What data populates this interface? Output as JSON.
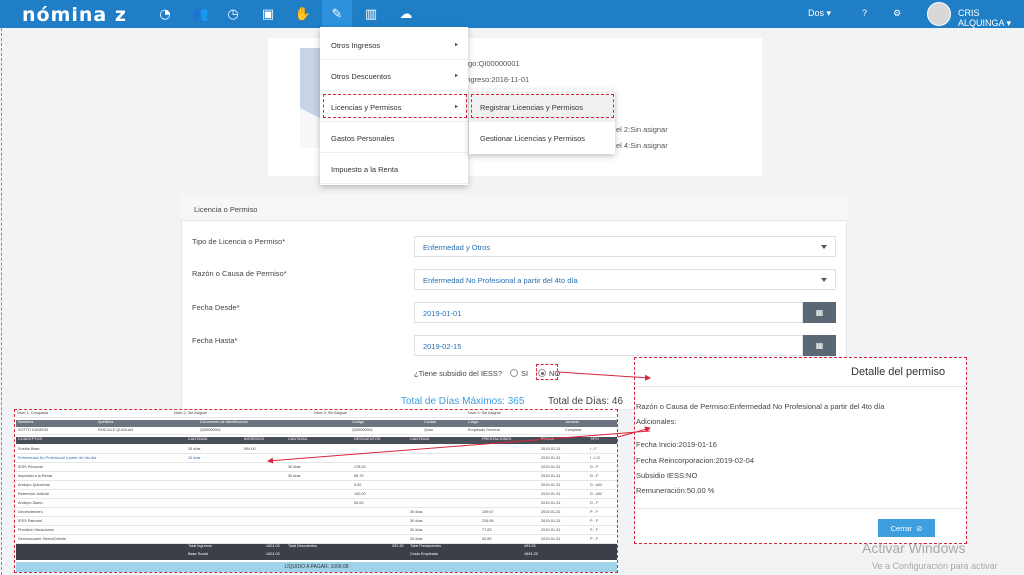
{
  "header": {
    "logo": "nómina z",
    "company": "Dos",
    "help": "?",
    "settings": "⚙",
    "user": "CRIS ALQUINGA"
  },
  "icons": [
    "dashboard-icon",
    "users-icon",
    "clock-icon",
    "briefcase-icon",
    "handshake-icon",
    "edit-icon",
    "chart-icon",
    "cloud-upload-icon"
  ],
  "profile": {
    "codigo_label": "go:",
    "codigo_value": "QI00000001",
    "ingreso_label": "a Ingreso:",
    "ingreso_value": "2018-11-01",
    "nivel2_label": "el 2:",
    "nivel2_value": "Sin asignar",
    "nivel4_label": "el 4:",
    "nivel4_value": "Sin asignar"
  },
  "menu": {
    "items": [
      "Otros Ingresos",
      "Otros Descuentos",
      "Licencias y Permisos",
      "Gastos Personales",
      "Impuesto a la Renta"
    ],
    "submenu": [
      "Registrar Licencias y Permisos",
      "Gestionar Licencias y Permisos"
    ]
  },
  "form": {
    "section_title": "Licencia o Permiso",
    "tipo_label": "Tipo de Licencia o Permiso",
    "tipo_value": "Enfermedad y Otros",
    "razon_label": "Razón o Causa de Permiso",
    "razon_value": "Enfermedad No Profesional a partir del 4to día",
    "desde_label": "Fecha Desde",
    "desde_value": "2019-01-01",
    "hasta_label": "Fecha Hasta",
    "hasta_value": "2019-02-15",
    "required_mark": "*",
    "subsidio_question": "¿Tiene subsidio del IESS?",
    "si": "SI",
    "no": "NO",
    "total_max": "Total de Días Máximos: 365",
    "total_dias": "Total de Días: 46"
  },
  "slip": {
    "top": [
      "Nivel 1: Compania",
      "Nivel 2: Sin Asignar",
      "Nivel 3: Sin Asignar",
      "Nivel 4: Sin Asignar"
    ],
    "hdr1": [
      "Nombres",
      "Apellidos",
      "Documento de Identificación",
      "Código",
      "Ciudad",
      "Cargo",
      "Jornada"
    ],
    "emp": [
      "XOTTO KASEEM",
      "PASCALE QUINLAN",
      "QI00000001",
      "QI00000001",
      "Quito",
      "Empleado General",
      "Completa"
    ],
    "hdr2": [
      "CONCEPTOS",
      "CANTIDAD",
      "INGRESOS",
      "CANTIDAD",
      "DESCUENTOS",
      "CANTIDAD",
      "PRESTACIONES",
      "FECHA",
      "TIPO"
    ],
    "rows": [
      [
        "Sueldo Base",
        "15 días",
        "594.00",
        "",
        "",
        "",
        "",
        "2019-01-31",
        "I - F"
      ],
      [
        "Enfermedad No Profesional a partir del 4to día",
        "15 días",
        "",
        "",
        "",
        "",
        "",
        "2019-01-31",
        "I - LIC"
      ],
      [
        "IESS Personal",
        "",
        "",
        "30 días",
        "178.53",
        "",
        "",
        "2019-01-31",
        "D - F"
      ],
      [
        "Impuesto a la Renta",
        "",
        "",
        "30 días",
        "65.79",
        "",
        "",
        "2019-01-31",
        "D - F"
      ],
      [
        "Anticipo Quincenal",
        "",
        "",
        "",
        "0.00",
        "",
        "",
        "2019-01-31",
        "D - AM"
      ],
      [
        "Retención Judicial",
        "",
        "",
        "",
        "100.00",
        "",
        "",
        "2019-01-31",
        "D - AM"
      ],
      [
        "Anticipo Diario",
        "",
        "",
        "",
        "50.00",
        "",
        "",
        "2019-01-31",
        "D - F"
      ],
      [
        "Decimotercero",
        "",
        "",
        "",
        "",
        "30 días",
        "159.67",
        "2019-01-31",
        "P - F"
      ],
      [
        "IESS Patronal",
        "",
        "",
        "",
        "",
        "30 días",
        "226.56",
        "2019-01-31",
        "P - F"
      ],
      [
        "Provisión Vacaciones",
        "",
        "",
        "",
        "",
        "30 días",
        "77.83",
        "2019-01-31",
        "P - F"
      ],
      [
        "Decimocuarto Sierra/Oriente",
        "",
        "",
        "",
        "",
        "30 días",
        "32.69",
        "2019-01-31",
        "P - F"
      ]
    ],
    "tot1": [
      "Total Ingresos",
      "1401.00",
      "Total Descuentos",
      "392.32",
      "Total Prestaciones",
      "493.25"
    ],
    "tot2": [
      "Base Social",
      "1401.00",
      "Costo Empleado",
      "1894.25"
    ],
    "liquido": "LÍQUIDO A PAGAR: 1008.68"
  },
  "detail": {
    "title": "Detalle del permiso",
    "razon": "Razón o Causa de Permiso:Enfermedad No Profesional a partir del 4to día",
    "adicionales": "Adicionales:",
    "inicio": "Fecha Inicio:2019-01-16",
    "reincorporacion": "Fecha Reincorporacion:2019-02-04",
    "subsidio": "Subsidio IESS:NO",
    "remuneracion": "Remuneración:50.00 %",
    "close": "Cerrar"
  },
  "watermark": {
    "line1": "Activar Windows",
    "line2": "Ve a Configuración para activar"
  },
  "colors": {
    "primary": "#1f7ec6",
    "accent": "#3d9ee0",
    "highlight": "#d9243c",
    "dark_button": "#5a6876"
  }
}
